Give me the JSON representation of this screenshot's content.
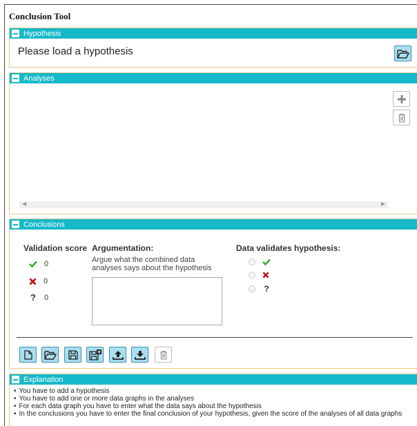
{
  "app": {
    "title": "Conclusion Tool"
  },
  "hypothesis": {
    "header": "Hypothesis",
    "placeholder_text": "Please load a hypothesis",
    "load_icon": "folder-open-icon"
  },
  "analyses": {
    "header": "Analyses",
    "add_icon": "plus-icon",
    "delete_icon": "trash-icon"
  },
  "conclusions": {
    "header": "Conclusions",
    "validation_score_title": "Validation score",
    "argumentation_title": "Argumentation:",
    "data_validates_title": "Data validates hypothesis:",
    "argumentation_hint": "Argue what the combined data analyses says about the hypothesis",
    "argumentation_value": "",
    "scores": [
      {
        "icon": "check-icon",
        "value": "0",
        "color": "#3aa832"
      },
      {
        "icon": "cross-icon",
        "value": "0",
        "color": "#c0141a"
      },
      {
        "icon": "question-icon",
        "value": "0",
        "color": "#222222"
      }
    ],
    "validation_options": [
      {
        "icon": "check-icon",
        "color": "#3aa832"
      },
      {
        "icon": "cross-icon",
        "color": "#c0141a"
      },
      {
        "icon": "question-icon",
        "symbol": "?",
        "color": "#222222"
      }
    ],
    "toolbar": [
      "new-file-icon",
      "open-folder-icon",
      "save-icon",
      "save-as-icon",
      "upload-icon",
      "download-icon",
      "delete-icon"
    ]
  },
  "explanation": {
    "header": "Explanation",
    "items": [
      "You have to add a hypothesis",
      "You have to add one or more data graphs in the analyses",
      "For each data graph you have to enter what the data says about the hypothesis",
      "In the conclusions you have to enter the final conclusion of your hypothesis, given the score of the analyses of all data graphs"
    ]
  },
  "colors": {
    "accent": "#16b9c9",
    "button_fill": "#a9dff0",
    "button_border": "#3a8fb0",
    "section_border": "#e8c98a"
  }
}
